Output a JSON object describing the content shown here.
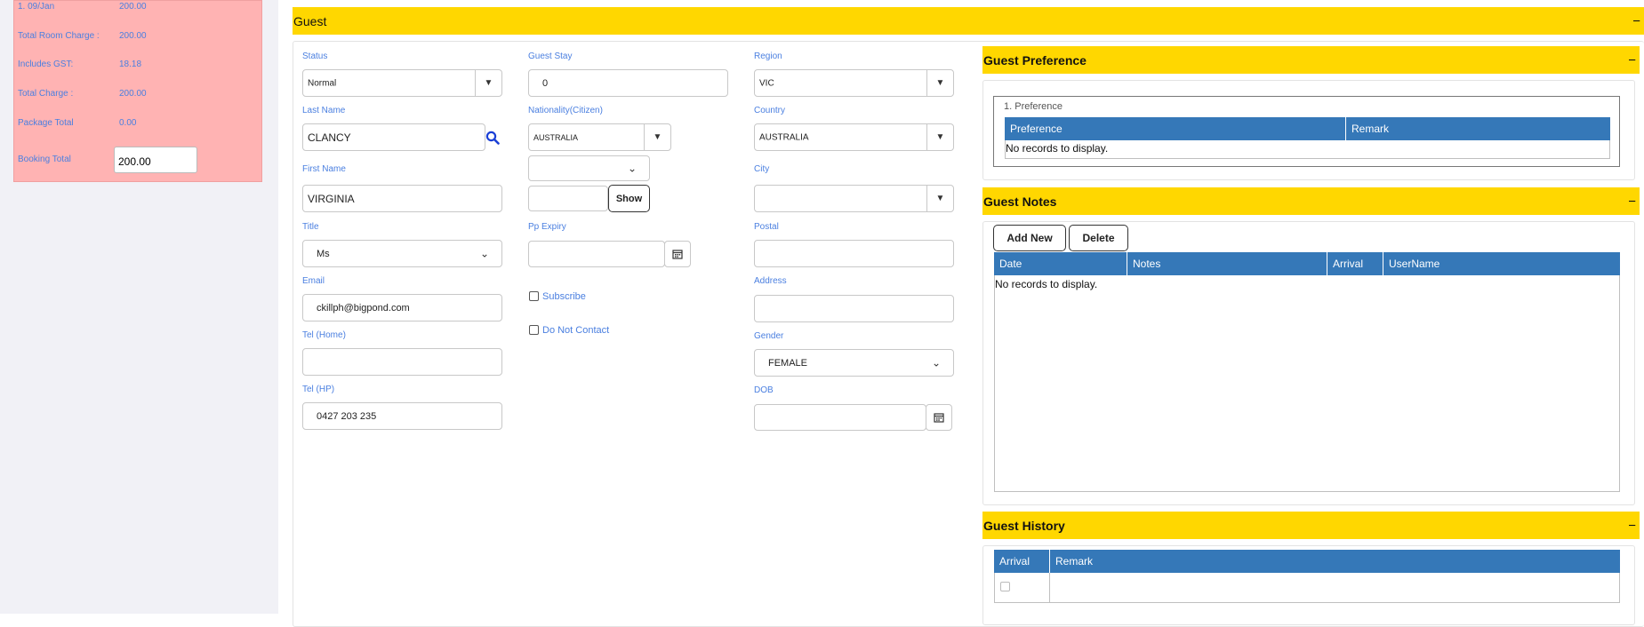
{
  "charges": {
    "rows": [
      {
        "label": "1. 09/Jan",
        "value": "200.00"
      },
      {
        "label": "Total Room Charge :",
        "value": "200.00"
      },
      {
        "label": "Includes GST:",
        "value": "18.18"
      },
      {
        "label": "Total Charge :",
        "value": "200.00"
      },
      {
        "label": "Package Total",
        "value": "0.00"
      }
    ],
    "booking_total_label": "Booking Total",
    "booking_total_value": "200.00"
  },
  "guest": {
    "title": "Guest",
    "collapse": "−",
    "status": {
      "label": "Status",
      "value": "Normal"
    },
    "guest_stay": {
      "label": "Guest Stay",
      "value": "0"
    },
    "region": {
      "label": "Region",
      "value": "VIC"
    },
    "last_name": {
      "label": "Last Name",
      "value": "CLANCY"
    },
    "nationality": {
      "label": "Nationality(Citizen)",
      "value": "AUSTRALIA"
    },
    "country": {
      "label": "Country",
      "value": "AUSTRALIA"
    },
    "first_name": {
      "label": "First Name",
      "value": "VIRGINIA"
    },
    "show_button": "Show",
    "city": {
      "label": "City",
      "value": ""
    },
    "title_field": {
      "label": "Title",
      "value": "Ms"
    },
    "pp_expiry": {
      "label": "Pp Expiry",
      "value": ""
    },
    "postal": {
      "label": "Postal",
      "value": ""
    },
    "email": {
      "label": "Email",
      "value": "ckillph@bigpond.com"
    },
    "subscribe": {
      "label": "Subscribe",
      "checked": false
    },
    "address": {
      "label": "Address",
      "value": ""
    },
    "tel_home": {
      "label": "Tel (Home)",
      "value": ""
    },
    "do_not_contact": {
      "label": "Do Not Contact",
      "checked": false
    },
    "gender": {
      "label": "Gender",
      "value": "FEMALE"
    },
    "tel_hp": {
      "label": "Tel (HP)",
      "value": "0427 203 235"
    },
    "dob": {
      "label": "DOB",
      "value": ""
    }
  },
  "preference": {
    "title": "Guest Preference",
    "collapse": "−",
    "group_title": "1. Preference",
    "columns": [
      "Preference",
      "Remark"
    ],
    "empty": "No records to display."
  },
  "notes": {
    "title": "Guest Notes",
    "collapse": "−",
    "add_new": "Add New",
    "delete": "Delete",
    "columns": [
      "Date",
      "Notes",
      "Arrival",
      "UserName"
    ],
    "empty": "No records to display."
  },
  "history": {
    "title": "Guest History",
    "collapse": "−",
    "columns": [
      "Arrival",
      "Remark"
    ]
  },
  "colors": {
    "section_bar": "#ffd700",
    "grid_header": "#3578b8",
    "label_blue": "#4a7fe0",
    "charges_bg": "#ffb3b3"
  }
}
